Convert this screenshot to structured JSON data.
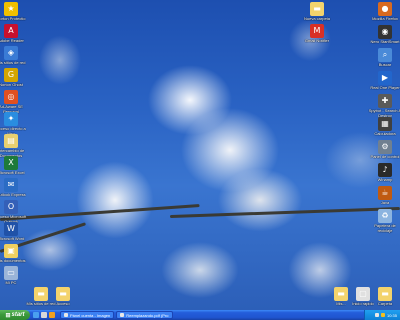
{
  "desktop": {
    "left_icons": [
      {
        "label": "Norton Protectio",
        "icon": "norton-icon",
        "color": "#f0c000",
        "glyph": "★"
      },
      {
        "label": "Adobe Reader",
        "icon": "adobe-reader-icon",
        "color": "#c8102e",
        "glyph": "A"
      },
      {
        "label": "Mis sitios de red",
        "icon": "network-places-icon",
        "color": "#3a7bd5",
        "glyph": "◈"
      },
      {
        "label": "Norton Ghost",
        "icon": "norton-ghost-icon",
        "color": "#d4a500",
        "glyph": "G"
      },
      {
        "label": "Ad-Aware SE Personal",
        "icon": "ad-aware-icon",
        "color": "#e05020",
        "glyph": "◎"
      },
      {
        "label": "Acceso directo a Msn",
        "icon": "msn-icon",
        "color": "#2a8de0",
        "glyph": "✦"
      },
      {
        "label": "Intercambio de Documentos",
        "icon": "documents-icon",
        "color": "#e8d070",
        "glyph": "▤"
      },
      {
        "label": "Microsoft Excel",
        "icon": "excel-icon",
        "color": "#1d7a3a",
        "glyph": "X"
      },
      {
        "label": "Outlook Express",
        "icon": "outlook-icon",
        "color": "#2b6cc4",
        "glyph": "✉"
      },
      {
        "label": "Acceso Microsoft Outlook",
        "icon": "outlook-icon",
        "color": "#3460b8",
        "glyph": "O"
      },
      {
        "label": "Microsoft Word",
        "icon": "word-icon",
        "color": "#2052a8",
        "glyph": "W"
      },
      {
        "label": "Mis documentos",
        "icon": "my-documents-icon",
        "color": "#f0d060",
        "glyph": "▣"
      },
      {
        "label": "Mi PC",
        "icon": "my-computer-icon",
        "color": "#9ab4d8",
        "glyph": "▭"
      }
    ],
    "bottom_icons": [
      {
        "label": "Mis sitios de red",
        "icon": "folder-icon",
        "color": "#f3d36c",
        "glyph": "▬"
      },
      {
        "label": "Acceso",
        "icon": "folder-icon",
        "color": "#f3d36c",
        "glyph": "▬"
      }
    ],
    "top_center_icons": [
      {
        "label": "Nueva carpeta",
        "icon": "folder-icon",
        "color": "#f3d36c",
        "glyph": "▬"
      },
      {
        "label": "Gmail Notifier",
        "icon": "gmail-icon",
        "color": "#d93025",
        "glyph": "M"
      }
    ],
    "right_icons": [
      {
        "label": "Mozilla Firefox",
        "icon": "firefox-icon",
        "color": "#d86a20",
        "glyph": "●"
      },
      {
        "label": "Nero StartSmart",
        "icon": "nero-icon",
        "color": "#333333",
        "glyph": "◉"
      },
      {
        "label": "Buscar",
        "icon": "search-icon",
        "color": "#4a8ad8",
        "glyph": "⌕"
      },
      {
        "label": "Real One Player",
        "icon": "realplayer-icon",
        "color": "#2266cc",
        "glyph": "▶"
      },
      {
        "label": "Spybot - Search & Destroy",
        "icon": "spybot-icon",
        "color": "#5a5a5a",
        "glyph": "✚"
      },
      {
        "label": "Calculadora",
        "icon": "calculator-icon",
        "color": "#404040",
        "glyph": "▦"
      },
      {
        "label": "Panel de control",
        "icon": "control-panel-icon",
        "color": "#708090",
        "glyph": "⚙"
      },
      {
        "label": "Winamp",
        "icon": "winamp-icon",
        "color": "#2a2a2a",
        "glyph": "♪"
      },
      {
        "label": "Java",
        "icon": "java-icon",
        "color": "#c05a10",
        "glyph": "☕"
      },
      {
        "label": "Papelera de reciclaje",
        "icon": "recycle-bin-icon",
        "color": "#8cb4e0",
        "glyph": "♻"
      }
    ],
    "bottom_right_icons": [
      {
        "label": "Mis...",
        "icon": "folder-icon",
        "color": "#f3d36c",
        "glyph": "▬"
      },
      {
        "label": "Inicio rapido",
        "icon": "quick-icon",
        "color": "#e0e0e0",
        "glyph": "▢"
      },
      {
        "label": "Carpeta",
        "icon": "folder-icon",
        "color": "#f3d36c",
        "glyph": "▬"
      }
    ]
  },
  "taskbar": {
    "start_label": "start",
    "quick_launch": [
      {
        "icon": "ie-icon",
        "color": "#4aa0f0"
      },
      {
        "icon": "show-desktop-icon",
        "color": "#d8d8d8"
      },
      {
        "icon": "media-player-icon",
        "color": "#f0a020"
      }
    ],
    "tasks": [
      {
        "label": "Pánel cuenta - Imagen",
        "icon": "window-icon"
      },
      {
        "label": "Reemplazando.pdf (Pro",
        "icon": "pdf-icon"
      }
    ],
    "tray": {
      "icons": [
        {
          "icon": "network-tray-icon",
          "color": "#e8e8e8"
        },
        {
          "icon": "antivirus-tray-icon",
          "color": "#f0c020"
        }
      ],
      "clock": "10:35"
    }
  }
}
